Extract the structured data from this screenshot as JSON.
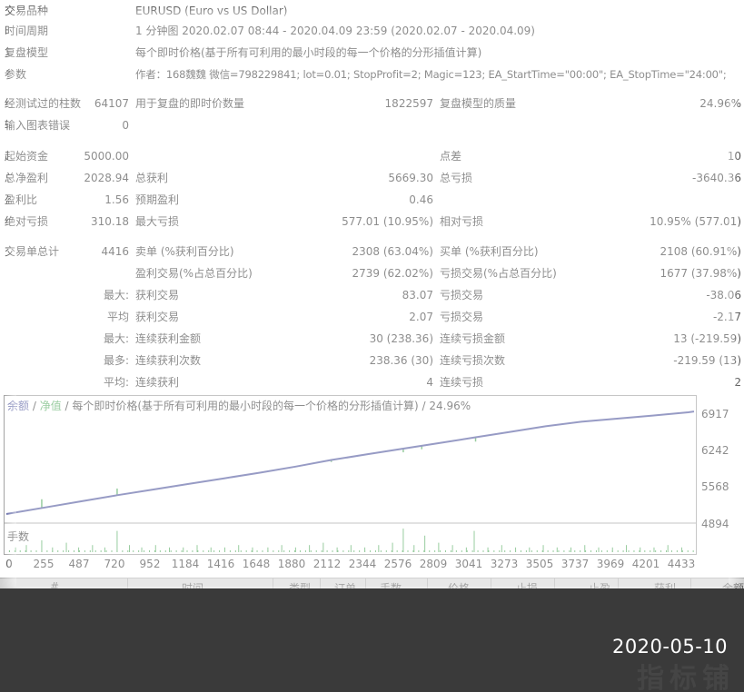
{
  "info": [
    {
      "label": "交易品种",
      "value": "EURUSD (Euro vs US Dollar)"
    },
    {
      "label": "时间周期",
      "value": "1 分钟图 2020.02.07 08:44 - 2020.04.09 23:59 (2020.02.07 - 2020.04.09)"
    },
    {
      "label": "复盘模型",
      "value": "每个即时价格(基于所有可利用的最小时段的每一个价格的分形插值计算)"
    },
    {
      "label": "参数",
      "value": "作者：168魏魏 微信=798229841; lot=0.01; StopProfit=2; Magic=123; EA_StartTime=\"00:00\"; EA_StopTime=\"24:00\";"
    }
  ],
  "bars_row": {
    "label1": "经测试过的柱数",
    "value1": "64107",
    "label2": "用于复盘的即时价数量",
    "value2": "1822597",
    "label3": "复盘模型的质量",
    "value3": "24.96%"
  },
  "errors_row": {
    "label1": "输入图表错误",
    "value1": "0"
  },
  "stats": [
    {
      "l1": "起始资金",
      "v1": "5000.00",
      "l2": "",
      "v2": "",
      "l3": "点差",
      "v3": "10"
    },
    {
      "l1": "总净盈利",
      "v1": "2028.94",
      "l2": "总获利",
      "v2": "5669.30",
      "l3": "总亏损",
      "v3": "-3640.36"
    },
    {
      "l1": "盈利比",
      "v1": "1.56",
      "l2": "预期盈利",
      "v2": "0.46",
      "l3": "",
      "v3": ""
    },
    {
      "l1": "绝对亏损",
      "v1": "310.18",
      "l2": "最大亏损",
      "v2": "577.01 (10.95%)",
      "l3": "相对亏损",
      "v3": "10.95% (577.01)"
    }
  ],
  "trades": [
    {
      "l1": "交易单总计",
      "v1": "4416",
      "l2": "卖单 (%获利百分比)",
      "v2": "2308 (63.04%)",
      "l3": "买单 (%获利百分比)",
      "v3": "2108 (60.91%)"
    },
    {
      "l1": "",
      "v1": "",
      "l2": "盈利交易(%占总百分比)",
      "v2": "2739 (62.02%)",
      "l3": "亏损交易(%占总百分比)",
      "v3": "1677 (37.98%)"
    },
    {
      "l1": "",
      "v1": "最大:",
      "l2": "获利交易",
      "v2": "83.07",
      "l3": "亏损交易",
      "v3": "-38.06"
    },
    {
      "l1": "",
      "v1": "平均",
      "l2": "获利交易",
      "v2": "2.07",
      "l3": "亏损交易",
      "v3": "-2.17"
    },
    {
      "l1": "",
      "v1": "最大:",
      "l2": "连续获利金额",
      "v2": "30 (238.36)",
      "l3": "连续亏损金额",
      "v3": "13 (-219.59)"
    },
    {
      "l1": "",
      "v1": "最多:",
      "l2": "连续获利次数",
      "v2": "238.36 (30)",
      "l3": "连续亏损次数",
      "v3": "-219.59 (13)"
    },
    {
      "l1": "",
      "v1": "平均:",
      "l2": "连续获利",
      "v2": "4",
      "l3": "连续亏损",
      "v3": "2"
    }
  ],
  "chart_title": {
    "balance": "余额",
    "sep1": " / ",
    "equity": "净值",
    "sep2": " / ",
    "rest": "每个即时价格(基于所有可利用的最小时段的每一个价格的分形插值计算) / 24.96%"
  },
  "volume_label": "手数",
  "colors": {
    "balance": "#1a237e",
    "equity": "#1b8f2a",
    "volume": "#1b8f2a"
  },
  "chart_data": {
    "type": "line",
    "x_ticks": [
      "0",
      "255",
      "487",
      "720",
      "952",
      "1184",
      "1416",
      "1648",
      "1880",
      "2112",
      "2344",
      "2576",
      "2809",
      "3041",
      "3273",
      "3505",
      "3737",
      "3969",
      "4201",
      "4433"
    ],
    "y_ticks": [
      "6917",
      "6242",
      "5568",
      "4894"
    ],
    "ylim": [
      4894,
      7030
    ],
    "xlim": [
      0,
      4470
    ],
    "series": [
      {
        "name": "余额",
        "x": [
          0,
          255,
          487,
          720,
          952,
          1184,
          1416,
          1648,
          1880,
          2112,
          2344,
          2576,
          2809,
          3041,
          3273,
          3505,
          3737,
          3969,
          4201,
          4433,
          4470
        ],
        "y": [
          5000,
          5130,
          5250,
          5370,
          5480,
          5590,
          5700,
          5810,
          5930,
          6060,
          6170,
          6280,
          6390,
          6500,
          6610,
          6720,
          6810,
          6870,
          6930,
          6995,
          7010
        ]
      },
      {
        "name": "净值",
        "spikes": [
          {
            "x": 230,
            "y": 5290
          },
          {
            "x": 720,
            "y": 5500
          },
          {
            "x": 2112,
            "y": 6020
          },
          {
            "x": 2580,
            "y": 6210
          },
          {
            "x": 2700,
            "y": 6270
          },
          {
            "x": 3050,
            "y": 6420
          }
        ]
      }
    ],
    "volume": {
      "x": [
        60,
        130,
        230,
        300,
        390,
        470,
        560,
        640,
        720,
        800,
        880,
        970,
        1060,
        1150,
        1240,
        1330,
        1420,
        1510,
        1600,
        1700,
        1790,
        1880,
        1970,
        2060,
        2150,
        2240,
        2330,
        2420,
        2510,
        2580,
        2650,
        2720,
        2810,
        2900,
        2990,
        3041,
        3130,
        3220,
        3310,
        3400,
        3490,
        3580,
        3670,
        3760,
        3850,
        3940,
        4030,
        4120,
        4210,
        4300,
        4390
      ],
      "y": [
        2,
        3,
        5,
        2,
        4,
        2,
        3,
        2,
        9,
        3,
        2,
        3,
        2,
        2,
        3,
        2,
        2,
        3,
        2,
        2,
        3,
        2,
        3,
        4,
        2,
        3,
        2,
        3,
        4,
        10,
        3,
        7,
        4,
        3,
        2,
        9,
        2,
        3,
        2,
        2,
        3,
        2,
        2,
        3,
        2,
        2,
        3,
        2,
        2,
        3,
        2
      ]
    }
  },
  "table_headers": [
    "#",
    "时间",
    "类型",
    "订单",
    "手数",
    "价格",
    "止损",
    "止盈",
    "获利",
    "余额"
  ],
  "date_stamp": "2020-05-10",
  "watermark": "指标铺"
}
